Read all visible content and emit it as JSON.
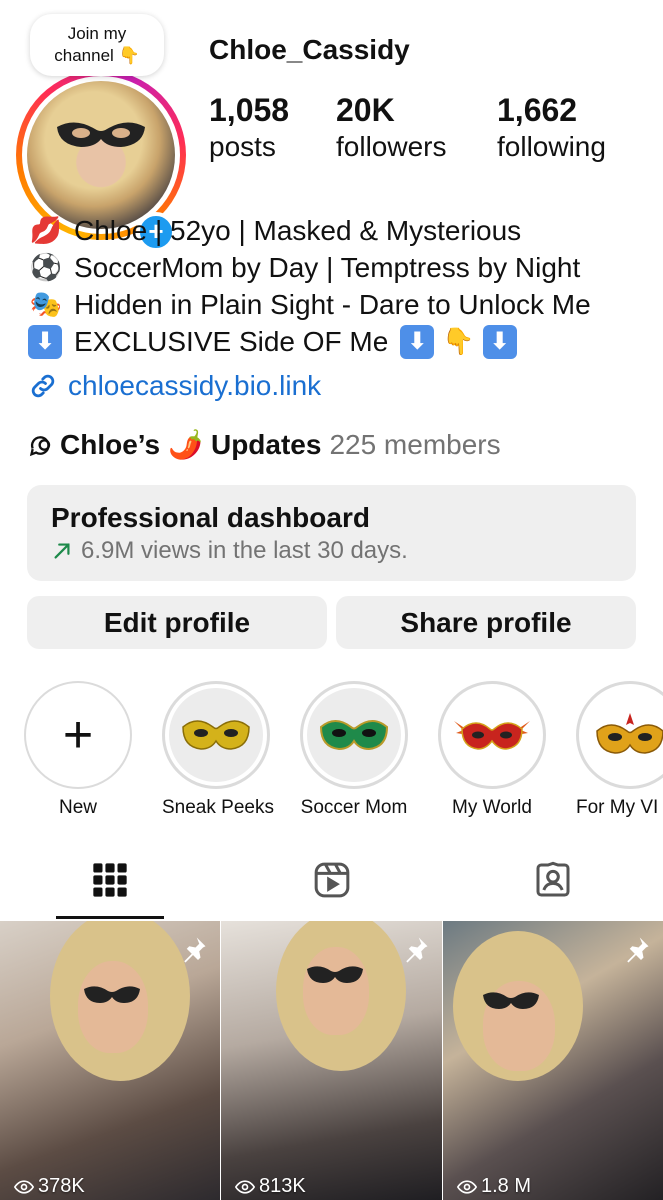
{
  "profile": {
    "username": "Chloe_Cassidy",
    "bubble_line1": "Join my",
    "bubble_line2": "channel 👇",
    "stats": {
      "posts_count": "1,058",
      "posts_label": "posts",
      "followers_count": "20K",
      "followers_label": "followers",
      "following_count": "1,662",
      "following_label": "following"
    }
  },
  "bio": {
    "line1_emoji": "💋",
    "line1": "Chloe | 52yo | Masked & Mysterious",
    "line2_emoji": "⚽",
    "line2": "SoccerMom by Day | Temptress by Night",
    "line3_emoji": "🎭",
    "line3": "Hidden in Plain Sight - Dare to Unlock Me",
    "line4_arrow": "⬇",
    "line4": "EXCLUSIVE Side OF Me",
    "line4_point": "👇",
    "link": "chloecassidy.bio.link"
  },
  "channel": {
    "name_prefix": "Chloe’s",
    "name_emoji": "🌶️",
    "name_suffix": "Updates",
    "members": "225 members"
  },
  "dashboard": {
    "title": "Professional dashboard",
    "subtitle": "6.9M views in the last 30 days."
  },
  "buttons": {
    "edit": "Edit profile",
    "share": "Share profile"
  },
  "highlights": [
    {
      "label": "New",
      "color": ""
    },
    {
      "label": "Sneak Peeks",
      "color": "#d4b21a"
    },
    {
      "label": "Soccer Mom",
      "color": "#1f8a4a"
    },
    {
      "label": "My World",
      "color": "#c8241e"
    },
    {
      "label": "For My VI",
      "color": "#e0a21a"
    }
  ],
  "posts": [
    {
      "views": "378K"
    },
    {
      "views": "813K"
    },
    {
      "views": "1.8 M"
    }
  ],
  "colors": {
    "accent_blue": "#1d9bf0",
    "link_blue": "#1a6fd1",
    "muted_text": "#737373",
    "button_bg": "#efefef"
  }
}
